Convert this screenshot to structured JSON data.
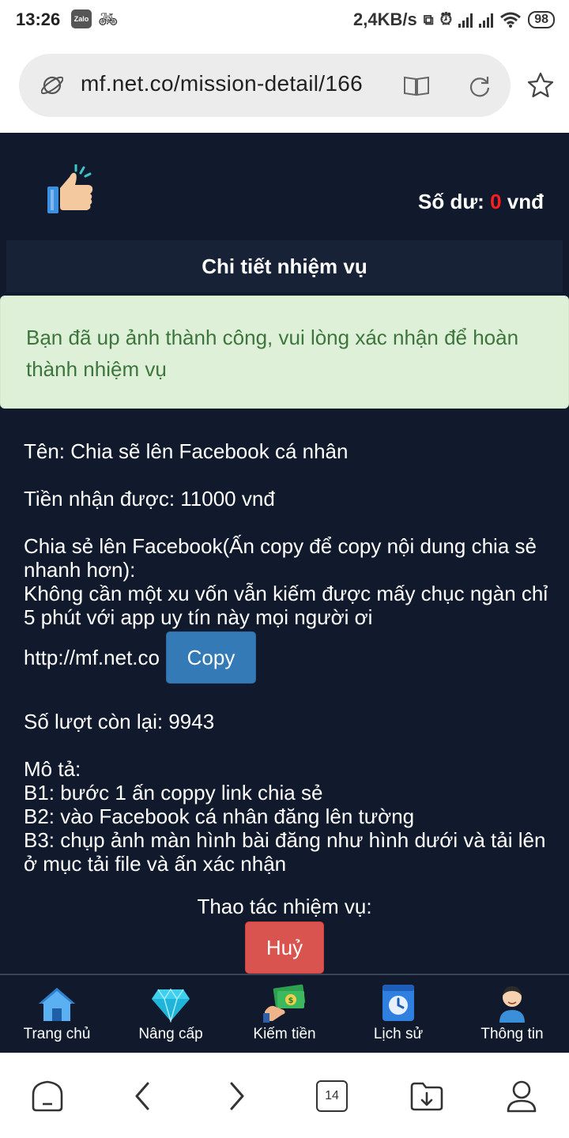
{
  "status_bar": {
    "time": "13:26",
    "zalo_label": "Zalo",
    "net_speed": "2,4KB/s",
    "battery": "98"
  },
  "browser": {
    "url": "mf.net.co/mission-detail/166",
    "tab_count": "14"
  },
  "header": {
    "balance_label": "Số dư:",
    "balance_value": "0",
    "balance_unit": "vnđ"
  },
  "page_title": "Chi tiết nhiệm vụ",
  "alert_message": "Bạn đã up ảnh thành công, vui lòng xác nhận để hoàn thành nhiệm vụ",
  "mission": {
    "name": "Tên: Chia sẽ lên Facebook cá nhân",
    "reward": "Tiền nhận được: 11000 vnđ",
    "share_instruction": "Chia sẻ lên Facebook(Ấn copy để copy nội dung chia sẻ nhanh hơn):",
    "share_content": "Không cần một xu vốn vẫn kiếm được mấy chục ngàn chỉ 5 phút với app uy tín này mọi người ơi",
    "share_link": "http://mf.net.co",
    "copy_label": "Copy",
    "remaining": "Số lượt còn lại: 9943",
    "description_label": "Mô tả:",
    "steps": [
      "B1: bước 1 ấn coppy link chia sẻ",
      "B2: vào Facebook cá nhân đăng lên tường",
      "B3: chụp ảnh màn hình bài đăng như hình dưới và tải lên ở mục tải file và ấn xác nhận"
    ],
    "actions_label": "Thao tác nhiệm vụ:",
    "cancel_label": "Huỷ"
  },
  "bottom_nav": [
    {
      "label": "Trang chủ",
      "icon": "home-icon"
    },
    {
      "label": "Nâng cấp",
      "icon": "diamond-icon"
    },
    {
      "label": "Kiếm tiền",
      "icon": "money-icon"
    },
    {
      "label": "Lịch sử",
      "icon": "history-icon"
    },
    {
      "label": "Thông tin",
      "icon": "user-icon"
    }
  ],
  "colors": {
    "page_bg": "#111a2c",
    "balance_zero": "#ff1e1e",
    "alert_bg": "#dff0d8",
    "alert_text": "#3c763d",
    "copy_button": "#337ab7",
    "cancel_button": "#d9534f"
  }
}
